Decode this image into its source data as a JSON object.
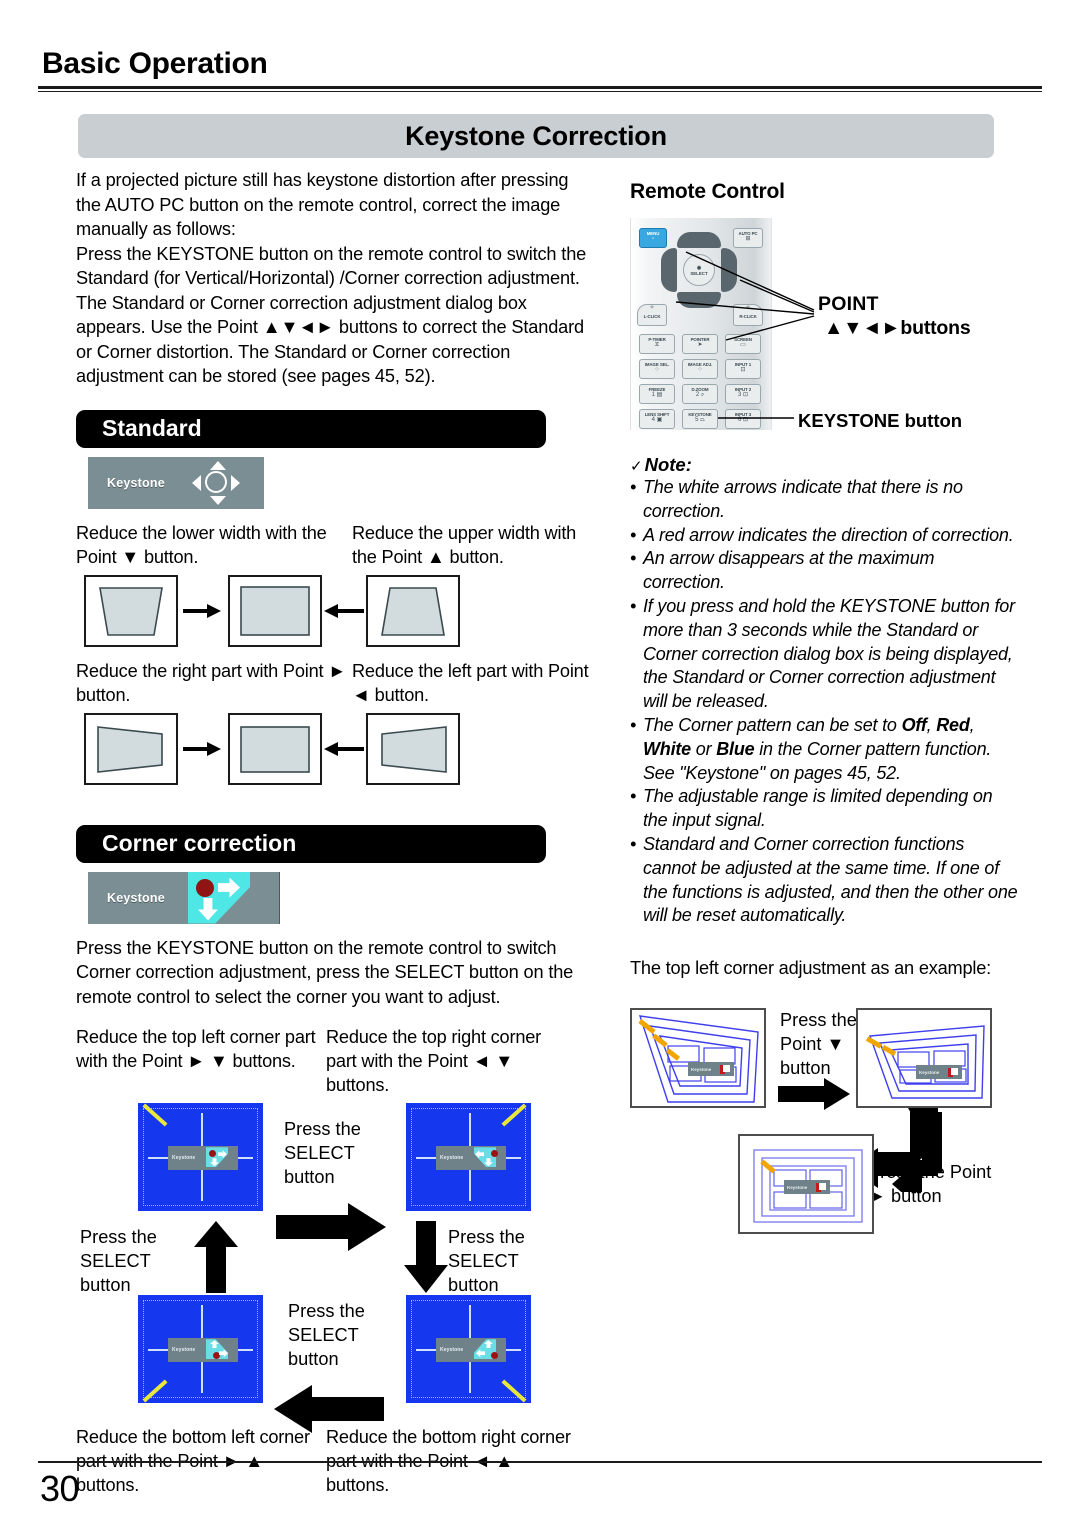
{
  "header": {
    "chapter": "Basic Operation",
    "title": "Keystone Correction"
  },
  "page_number": "30",
  "left": {
    "intro": "If a projected picture still has keystone distortion after pressing the AUTO PC button on the remote control, correct the image manually as follows:\nPress the KEYSTONE button on the remote control to switch the Standard (for Vertical/Horizontal) /Corner correction adjustment. The Standard or Corner correction adjustment dialog box appears. Use the Point ▲▼◄► buttons to correct the Standard or Corner distortion. The Standard or Corner correction adjustment can be stored (see pages 45, 52).",
    "standard": {
      "bar_label": "Standard",
      "osd_label": "Keystone",
      "cap_lower": "Reduce the lower width with the Point ▼ button.",
      "cap_upper": "Reduce the upper width with the Point ▲ button.",
      "cap_right": "Reduce the right part with Point ► button.",
      "cap_left": "Reduce the  left  part with Point ◄ button."
    },
    "corner": {
      "bar_label": "Corner correction",
      "osd_label": "Keystone",
      "intro": "Press the KEYSTONE button on the remote control to switch Corner correction adjustment, press the SELECT button on the remote control to select the corner you want to adjust.",
      "cap_top_left": "Reduce the top left corner part with the Point ► ▼ buttons.",
      "cap_top_right": "Reduce the top right corner part with the Point ◄ ▼ buttons.",
      "cap_bottom_left": "Reduce the bottom left corner part with the Point ► ▲ buttons.",
      "cap_bottom_right": "Reduce the bottom right corner part with the Point ◄ ▲ buttons.",
      "press_select_top": "Press the\nSELECT\nbutton",
      "press_select_left": "Press the\nSELECT\nbutton",
      "press_select_right": "Press the\nSELECT\nbutton",
      "press_select_bottom": "Press the\nSELECT\nbutton",
      "screen_osd_label": "Keystone"
    }
  },
  "right": {
    "remote_heading": "Remote Control",
    "point_label_line1": "POINT",
    "point_label_line2": "▲▼◄►buttons",
    "keystone_label": "KEYSTONE button",
    "remote_keys": {
      "menu": "MENU",
      "auto_pc": "AUTO PC",
      "select": "SELECT",
      "l_click": "L-CLICK",
      "r_click": "R-CLICK",
      "p_timer": "P-TIMER",
      "pointer": "POINTER",
      "screen": "SCREEN",
      "image_sel": "IMAGE SEL.",
      "image_adj": "IMAGE ADJ.",
      "input1": "INPUT 1",
      "freeze": "FREEZE",
      "d_zoom": "D.ZOOM",
      "input2": "INPUT 2",
      "lens_shift": "LENS SHIFT",
      "keystone": "KEYSTONE",
      "input3": "INPUT 3",
      "num1": "1",
      "num2": "2",
      "num3": "3",
      "num4": "4",
      "num5": "5",
      "num6": "6"
    },
    "note": {
      "title": "Note:",
      "check": "✓",
      "items": [
        "The white arrows indicate that there is no correction.",
        "A red arrow indicates the direction of correction.",
        "An arrow disappears at the maximum correction.",
        "If you press and hold the KEYSTONE button for more than 3 seconds while the Standard or Corner correction dialog box is being displayed, the Standard or Corner correction adjustment will be released.",
        "The Corner pattern can be set to Off, Red, White or Blue in the Corner pattern function. See \"Keystone\" on pages 45, 52.",
        "The adjustable range is limited depending on the input signal.",
        "Standard and Corner correction functions cannot be adjusted at the same time. If one of the functions is adjusted, and then the other one will be reset automatically."
      ],
      "bold_terms": [
        "Off",
        "Red",
        "White",
        "Blue"
      ]
    },
    "example": {
      "intro": "The top left corner adjustment as an example:",
      "press_point_down": "Press the\nPoint ▼\nbutton",
      "press_point_right": "Press the Point\n►  button",
      "osd_label": "Keystone"
    }
  },
  "colors": {
    "title_bar_bg": "#c9ced2",
    "section_bar_bg": "#000000",
    "osd_bg": "#7b8e93",
    "osd_accent_cyan": "#4fe6e6",
    "osd_accent_red": "#8f1414",
    "screen_blue": "#1538ee",
    "pattern_line": "#4040ff",
    "highlight_yellow": "#e8e83c",
    "example_dash_orange": "#f0a500",
    "screen_shape_fill": "#d2dcdf"
  }
}
